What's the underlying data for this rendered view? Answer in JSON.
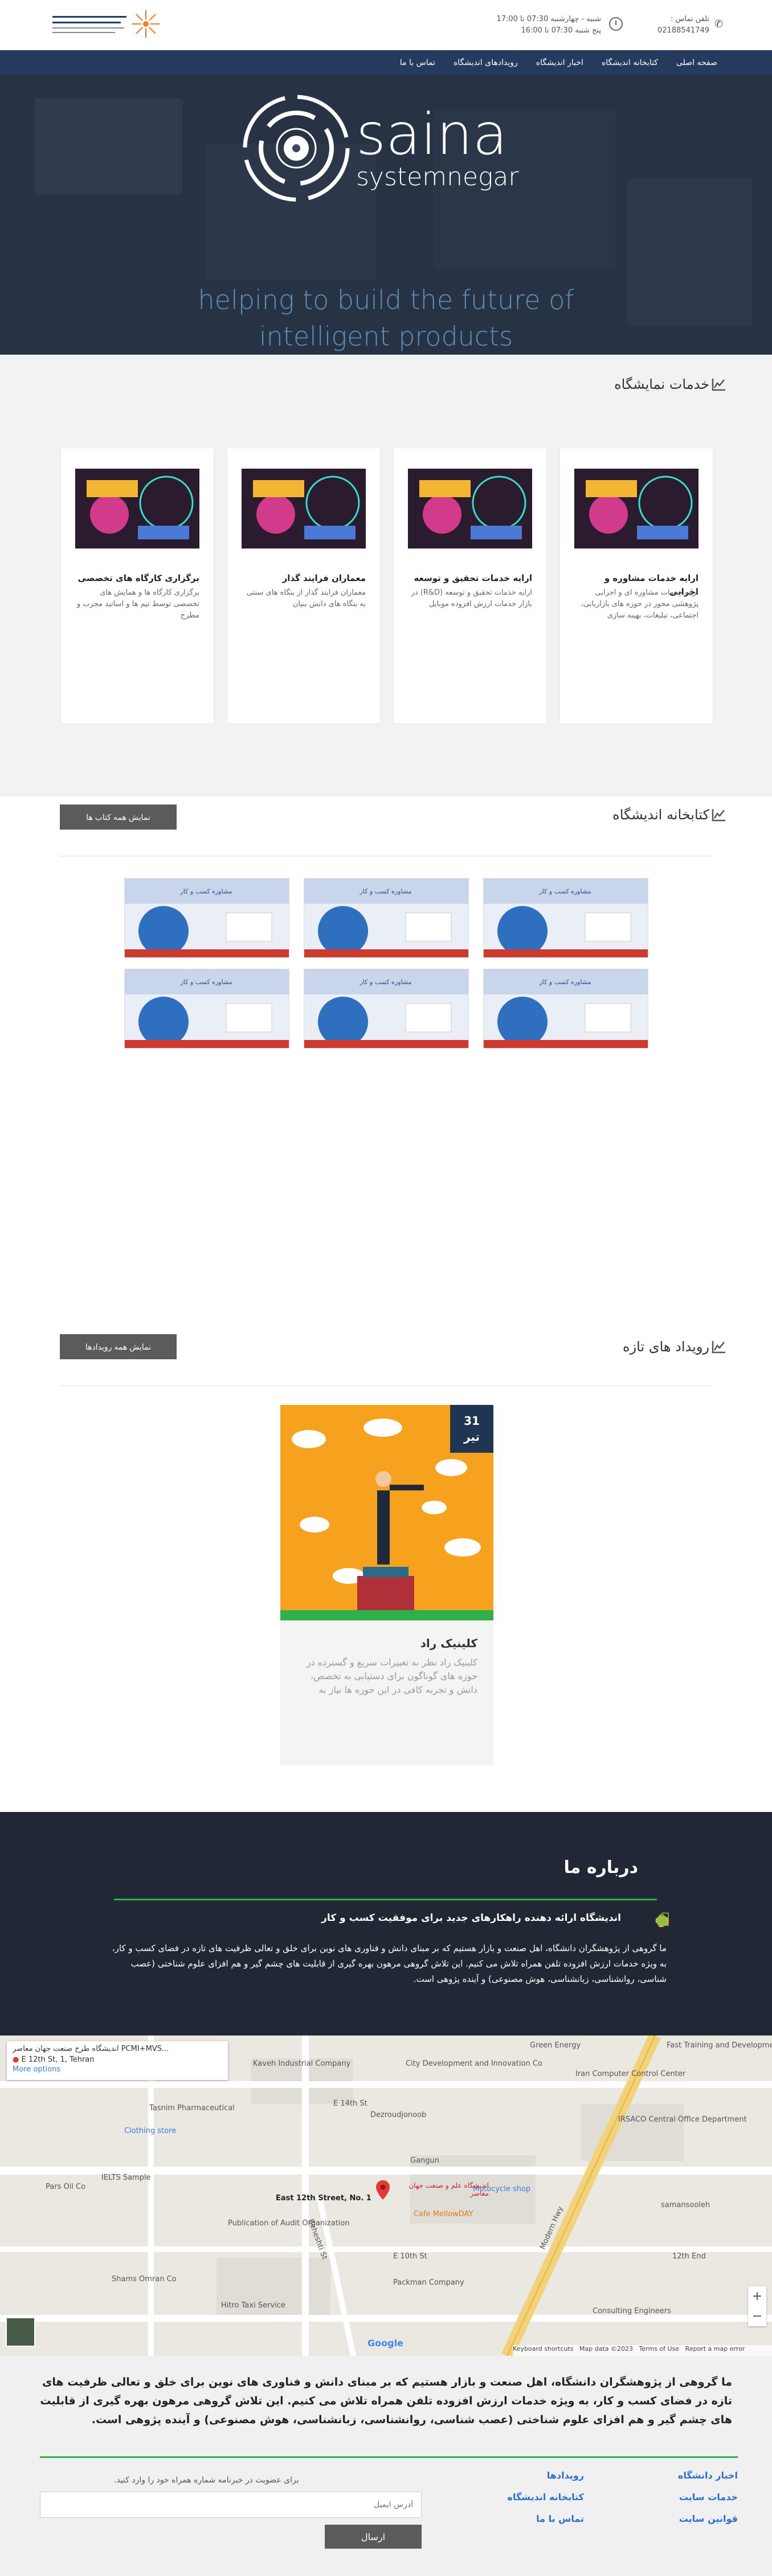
{
  "topbar": {
    "phone_label": "تلفن تماس :",
    "phone_number": "02188541749",
    "hours_line1": "شنبه - چهارشنبه 07:30 تا 17:00",
    "hours_line2": "پنج شنبه 07:30 تا 16:00"
  },
  "nav": {
    "items": [
      "صفحه اصلی",
      "کتابخانه اندیشگاه",
      "اخبار اندیشگاه",
      "رویدادهای اندیشگاه",
      "تماس با ما"
    ]
  },
  "hero": {
    "logo_word": "saina",
    "logo_sub": "systemnegar",
    "tagline_line1": "helping to build the future of",
    "tagline_line2": "intelligent products"
  },
  "services": {
    "title": "خدمات نمایشگاه",
    "cards": [
      {
        "title": "ارایه خدمات مشاوره و اجرایی",
        "text": "ارایه خدمات مشاوره ای و اجرایی پژوهشی محور در حوزه های بازاریابی، اجتماعی، تبلیغات، بهینه سازی"
      },
      {
        "title": "ارایه خدمات تحقیق و توسعه",
        "text": "ارایه خدمات تحقیق و توسعه (R&D) در بازار خدمات ارزش افزوده موبایل"
      },
      {
        "title": "معماران فرایند گذار",
        "text": "معماران فرایند گذار از بنگاه های سنتی به بنگاه های دانش بنیان"
      },
      {
        "title": "برگزاری کارگاه های تخصصی",
        "text": "برگزاری کارگاه ها و همایش های تخصصی توسط تیم ها و اساتید مجرب و مطرح"
      }
    ]
  },
  "library": {
    "title": "کتابخانه اندیشگاه",
    "button": "نمایش همه کتاب ها",
    "book_caption": "مشاوره کسب و کار"
  },
  "events": {
    "title": "رویداد های تازه",
    "button": "نمایش همه رویدادها",
    "card": {
      "day": "31",
      "month": "تیر",
      "title": "کلینیک راد",
      "text": "کلینیک راد نظر به تغییرات سریع و گسترده در حوزه های گوناگون برای دستیابی به تخصص، دانش و تجربه کافی در این حوزه ها نیاز به"
    }
  },
  "about": {
    "title": "درباره ما",
    "subtitle": "اندیشگاه ارائه دهنده راهکارهای جدید برای موفقیت کسب و کار",
    "text": "ما گروهی از پژوهشگران دانشگاه، اهل صنعت و بازار هستیم که بر مبنای دانش و فناوری های نوین برای خلق و تعالی ظرفیت های تازه در فضای کسب و کار، به ویژه خدمات ارزش افزوده تلفن همراه تلاش می کنیم. این تلاش گروهی مرهون بهره گیری از قابلیت های چشم گیر و هم افزای علوم شناختی (عصب شناسی، روانشناسی، زبانشناسی، هوش مصنوعی) و آینده پژوهی است."
  },
  "map": {
    "info_title": "اندیشگاه طرح صنعت جهان معاصر PCMI+MVS...",
    "info_address": "E 12th St, 1, Tehran",
    "info_more": "More options",
    "labels": {
      "kaveh": "Kaveh Industrial Company",
      "city_dev": "City Development and Innovation Co",
      "green": "Green Energy",
      "fast": "Fast Training and Development Center",
      "iran_comp": "Iran Computer Control Center",
      "tasnim": "Tasnim Pharmaceutical",
      "e14": "E 14th St",
      "dezroud": "Dezroudjonoob",
      "clothing": "Clothing store",
      "irsaco": "IRSACO Central Office Department",
      "ielts": "IELTS Sample",
      "gangun": "Gangun",
      "modern": "Modern Hwy",
      "motocycle": "Motocycle shop",
      "pars_oil": "Pars Oil Co",
      "samansoo": "samansooleh",
      "street12": "East 12th Street, No. 1",
      "pub_org": "Publication of Audit Organization",
      "beheshti": "Beheshti St",
      "cafe": "Cafe MellowDAY",
      "e12": "12th End",
      "shams": "Shams Omran Co",
      "e10": "E 10th St",
      "packman": "Packman Company",
      "hitro": "Hitro Taxi Service",
      "cons": "Consulting Engineers",
      "marker_name": "اندیشگاه علم و صنعت جهان معاصر",
      "zoom_in": "+",
      "zoom_out": "−",
      "google": "Google",
      "kb": "Keyboard shortcuts",
      "mapdata": "Map data ©2023",
      "terms": "Terms of Use",
      "report": "Report a map error"
    }
  },
  "footer": {
    "text": "ما گروهی از پژوهشگران دانشگاه، اهل صنعت و بازار هستیم که بر مبنای دانش و فناوری های نوین برای خلق و تعالی ظرفیت های تازه در فضای کسب و کار، به ویژه خدمات ارزش افزوده تلفن همراه تلاش می کنیم. این تلاش گروهی مرهون بهره گیری از قابلیت های چشم گیر و هم افزای علوم شناختی (عصب شناسی، روانشناسی، زبانشناسی، هوش مصنوعی) و آینده پژوهی است.",
    "links_col1": [
      "اخبار دانشگاه",
      "خدمات سایت",
      "قوانین سایت"
    ],
    "links_col2": [
      "رویدادها",
      "کتابخانه اندیشگاه",
      "تماس با ما"
    ],
    "newsletter_note": "برای عضویت در خبرنامه شماره همراه خود را وارد کنید.",
    "email_placeholder": "آدرس ایمیل",
    "send": "ارسال"
  },
  "colors": {
    "nav": "#253a5c",
    "accent_green": "#2fb04a",
    "about_bg": "#222735",
    "link_blue": "#2a6fd6"
  }
}
